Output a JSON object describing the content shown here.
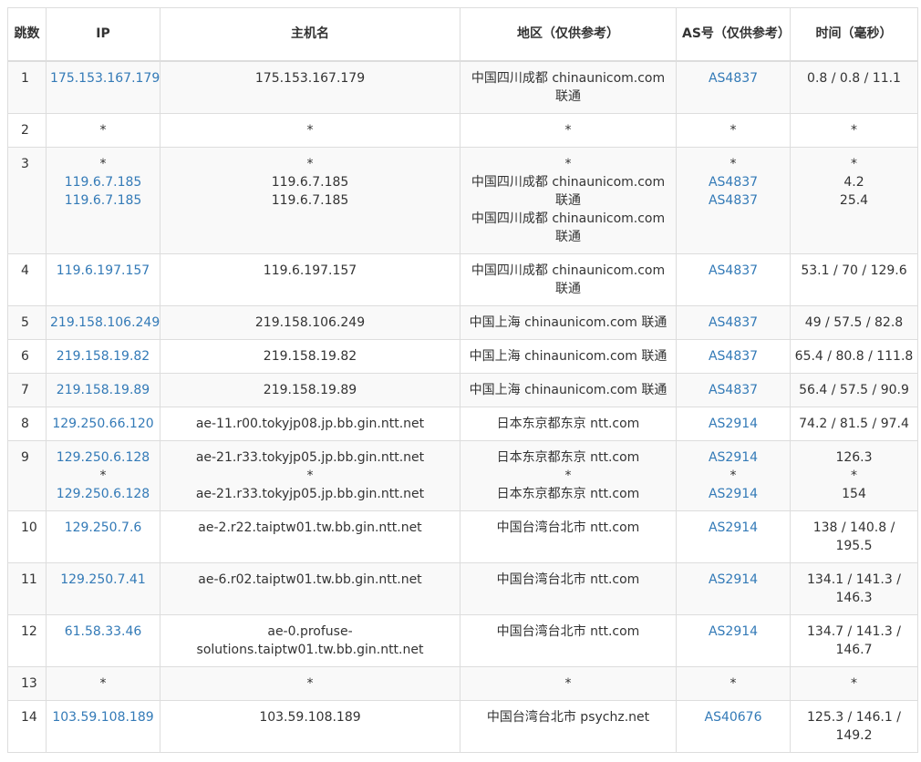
{
  "headers": [
    "跳数",
    "IP",
    "主机名",
    "地区（仅供参考）",
    "AS号（仅供参考）",
    "时间（毫秒）"
  ],
  "rows": [
    {
      "hop": "1",
      "ip": [
        "175.153.167.179"
      ],
      "host": [
        "175.153.167.179"
      ],
      "loc": [
        "中国四川成都 chinaunicom.com 联通"
      ],
      "as": [
        "AS4837"
      ],
      "time": [
        "0.8 / 0.8 / 11.1"
      ]
    },
    {
      "hop": "2",
      "ip": [
        "*"
      ],
      "host": [
        "*"
      ],
      "loc": [
        "*"
      ],
      "as": [
        "*"
      ],
      "time": [
        "*"
      ]
    },
    {
      "hop": "3",
      "ip": [
        "*",
        "119.6.7.185",
        "119.6.7.185"
      ],
      "host": [
        "*",
        "119.6.7.185",
        "119.6.7.185"
      ],
      "loc": [
        "*",
        "中国四川成都 chinaunicom.com 联通",
        "中国四川成都 chinaunicom.com 联通"
      ],
      "as": [
        "*",
        "AS4837",
        "AS4837"
      ],
      "time": [
        "*",
        "4.2",
        "25.4"
      ]
    },
    {
      "hop": "4",
      "ip": [
        "119.6.197.157"
      ],
      "host": [
        "119.6.197.157"
      ],
      "loc": [
        "中国四川成都 chinaunicom.com 联通"
      ],
      "as": [
        "AS4837"
      ],
      "time": [
        "53.1 / 70 / 129.6"
      ]
    },
    {
      "hop": "5",
      "ip": [
        "219.158.106.249"
      ],
      "host": [
        "219.158.106.249"
      ],
      "loc": [
        "中国上海 chinaunicom.com 联通"
      ],
      "as": [
        "AS4837"
      ],
      "time": [
        "49 / 57.5 / 82.8"
      ]
    },
    {
      "hop": "6",
      "ip": [
        "219.158.19.82"
      ],
      "host": [
        "219.158.19.82"
      ],
      "loc": [
        "中国上海 chinaunicom.com 联通"
      ],
      "as": [
        "AS4837"
      ],
      "time": [
        "65.4 / 80.8 / 111.8"
      ]
    },
    {
      "hop": "7",
      "ip": [
        "219.158.19.89"
      ],
      "host": [
        "219.158.19.89"
      ],
      "loc": [
        "中国上海 chinaunicom.com 联通"
      ],
      "as": [
        "AS4837"
      ],
      "time": [
        "56.4 / 57.5 / 90.9"
      ]
    },
    {
      "hop": "8",
      "ip": [
        "129.250.66.120"
      ],
      "host": [
        "ae-11.r00.tokyjp08.jp.bb.gin.ntt.net"
      ],
      "loc": [
        "日本东京都东京 ntt.com"
      ],
      "as": [
        "AS2914"
      ],
      "time": [
        "74.2 / 81.5 / 97.4"
      ]
    },
    {
      "hop": "9",
      "ip": [
        "129.250.6.128",
        "*",
        "129.250.6.128"
      ],
      "host": [
        "ae-21.r33.tokyjp05.jp.bb.gin.ntt.net",
        "*",
        "ae-21.r33.tokyjp05.jp.bb.gin.ntt.net"
      ],
      "loc": [
        "日本东京都东京 ntt.com",
        "*",
        "日本东京都东京 ntt.com"
      ],
      "as": [
        "AS2914",
        "*",
        "AS2914"
      ],
      "time": [
        "126.3",
        "*",
        "154"
      ]
    },
    {
      "hop": "10",
      "ip": [
        "129.250.7.6"
      ],
      "host": [
        "ae-2.r22.taiptw01.tw.bb.gin.ntt.net"
      ],
      "loc": [
        "中国台湾台北市 ntt.com"
      ],
      "as": [
        "AS2914"
      ],
      "time": [
        "138 / 140.8 / 195.5"
      ]
    },
    {
      "hop": "11",
      "ip": [
        "129.250.7.41"
      ],
      "host": [
        "ae-6.r02.taiptw01.tw.bb.gin.ntt.net"
      ],
      "loc": [
        "中国台湾台北市 ntt.com"
      ],
      "as": [
        "AS2914"
      ],
      "time": [
        "134.1 / 141.3 / 146.3"
      ]
    },
    {
      "hop": "12",
      "ip": [
        "61.58.33.46"
      ],
      "host": [
        "ae-0.profuse-solutions.taiptw01.tw.bb.gin.ntt.net"
      ],
      "loc": [
        "中国台湾台北市 ntt.com"
      ],
      "as": [
        "AS2914"
      ],
      "time": [
        "134.7 / 141.3 / 146.7"
      ]
    },
    {
      "hop": "13",
      "ip": [
        "*"
      ],
      "host": [
        "*"
      ],
      "loc": [
        "*"
      ],
      "as": [
        "*"
      ],
      "time": [
        "*"
      ]
    },
    {
      "hop": "14",
      "ip": [
        "103.59.108.189"
      ],
      "host": [
        "103.59.108.189"
      ],
      "loc": [
        "中国台湾台北市 psychz.net"
      ],
      "as": [
        "AS40676"
      ],
      "time": [
        "125.3 / 146.1 / 149.2"
      ]
    }
  ]
}
